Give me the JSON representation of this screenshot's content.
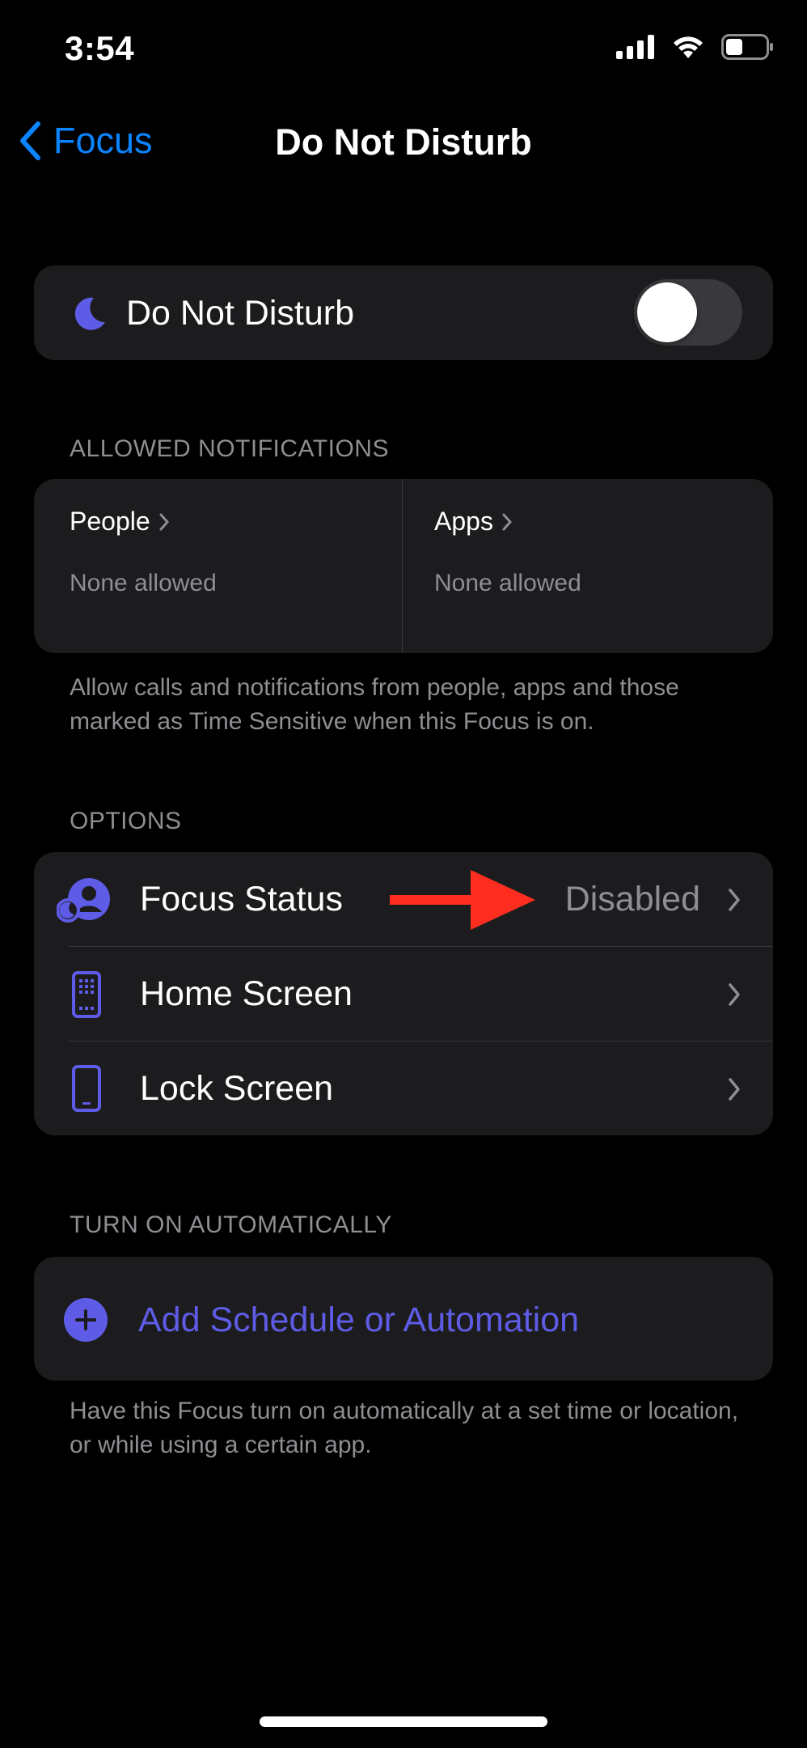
{
  "status_bar": {
    "time": "3:54"
  },
  "nav": {
    "back_label": "Focus",
    "title": "Do Not Disturb"
  },
  "dnd": {
    "label": "Do Not Disturb",
    "enabled": false
  },
  "allowed": {
    "header": "ALLOWED NOTIFICATIONS",
    "people": {
      "title": "People",
      "subtitle": "None allowed"
    },
    "apps": {
      "title": "Apps",
      "subtitle": "None allowed"
    },
    "footnote": "Allow calls and notifications from people, apps and those marked as Time Sensitive when this Focus is on."
  },
  "options": {
    "header": "OPTIONS",
    "items": [
      {
        "label": "Focus Status",
        "value": "Disabled",
        "icon": "focus-status-icon"
      },
      {
        "label": "Home Screen",
        "value": "",
        "icon": "home-screen-icon"
      },
      {
        "label": "Lock Screen",
        "value": "",
        "icon": "lock-screen-icon"
      }
    ]
  },
  "automation": {
    "header": "TURN ON AUTOMATICALLY",
    "add_label": "Add Schedule or Automation",
    "footnote": "Have this Focus turn on automatically at a set time or location, or while using a certain app."
  },
  "colors": {
    "accent": "#5e5ce6",
    "link": "#0a84ff",
    "annotation_arrow": "#ff2d1f"
  }
}
